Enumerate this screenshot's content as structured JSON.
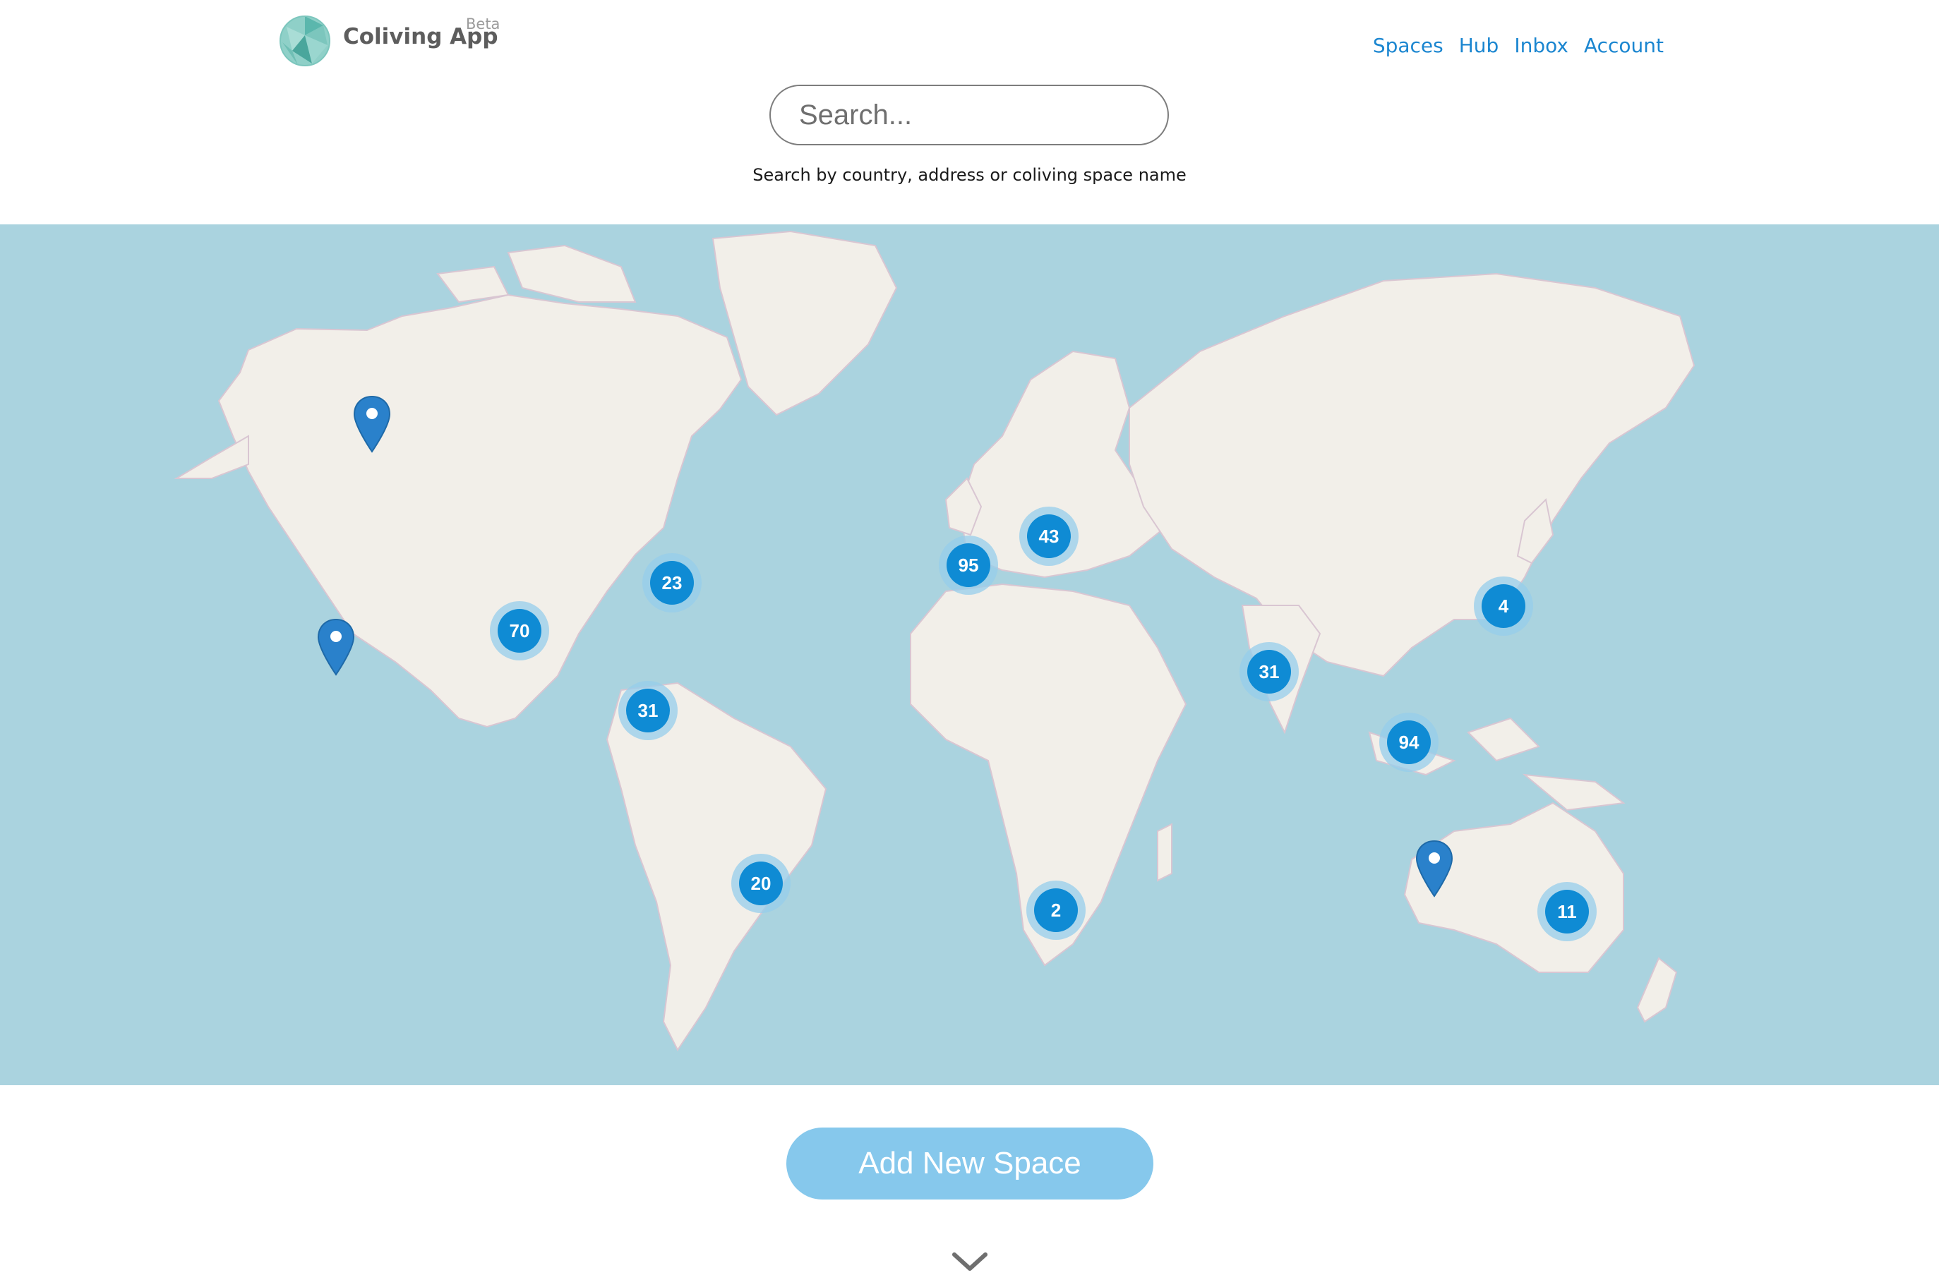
{
  "header": {
    "brand": "Coliving App",
    "badge": "Beta",
    "nav": [
      "Spaces",
      "Hub",
      "Inbox",
      "Account"
    ]
  },
  "search": {
    "placeholder": "Search...",
    "value": "",
    "hint": "Search by country, address or coliving space name"
  },
  "map": {
    "clusters": [
      {
        "region": "north-america-west",
        "count": "70"
      },
      {
        "region": "north-america-east",
        "count": "23"
      },
      {
        "region": "central-america",
        "count": "31"
      },
      {
        "region": "south-america",
        "count": "20"
      },
      {
        "region": "western-europe",
        "count": "95"
      },
      {
        "region": "central-europe",
        "count": "43"
      },
      {
        "region": "southern-africa",
        "count": "2"
      },
      {
        "region": "south-asia",
        "count": "31"
      },
      {
        "region": "southeast-asia",
        "count": "94"
      },
      {
        "region": "east-asia",
        "count": "4"
      },
      {
        "region": "australia-east",
        "count": "11"
      }
    ],
    "pins": [
      "alaska",
      "hawaii",
      "western-australia"
    ],
    "colors": {
      "water": "#aad3df",
      "land": "#f2efe9",
      "cluster": "#0f8bd4",
      "cluster_halo": "#96cdeb",
      "pin": "#2a81cb"
    }
  },
  "actions": {
    "add_space": "Add New Space"
  },
  "icons": {
    "logo": "globe-logo-icon",
    "scroll": "chevron-down-icon",
    "pin": "map-pin-icon"
  }
}
